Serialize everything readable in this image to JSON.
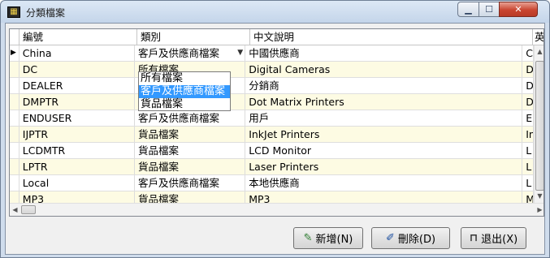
{
  "window": {
    "title": "分類檔案",
    "app_icon": "app-grid-icon"
  },
  "grid": {
    "columns": [
      "編號",
      "類別",
      "中文說明",
      "英"
    ],
    "rows": [
      {
        "code": "China",
        "category": "客戶及供應商檔案",
        "desc": "中國供應商",
        "en": "C"
      },
      {
        "code": "DC",
        "category": "所有檔案",
        "desc": "Digital Cameras",
        "en": "D"
      },
      {
        "code": "DEALER",
        "category": "",
        "desc": "分銷商",
        "en": "D"
      },
      {
        "code": "DMPTR",
        "category": "",
        "desc": "Dot Matrix Printers",
        "en": "D"
      },
      {
        "code": "ENDUSER",
        "category": "客戶及供應商檔案",
        "desc": "用戶",
        "en": "E"
      },
      {
        "code": "IJPTR",
        "category": "貨品檔案",
        "desc": "InkJet Printers",
        "en": "In"
      },
      {
        "code": "LCDMTR",
        "category": "貨品檔案",
        "desc": "LCD Monitor",
        "en": "L"
      },
      {
        "code": "LPTR",
        "category": "貨品檔案",
        "desc": "Laser Printers",
        "en": "L"
      },
      {
        "code": "Local",
        "category": "客戶及供應商檔案",
        "desc": "本地供應商",
        "en": "L"
      },
      {
        "code": "MP3",
        "category": "貨品檔案",
        "desc": "MP3",
        "en": "M"
      }
    ],
    "current_row_marker": "▶"
  },
  "dropdown": {
    "options": [
      "所有檔案",
      "客戶及供應商檔案",
      "貨品檔案"
    ],
    "selected_index": 1
  },
  "buttons": {
    "add": "新增(N)",
    "delete": "刪除(D)",
    "exit": "退出(X)"
  }
}
